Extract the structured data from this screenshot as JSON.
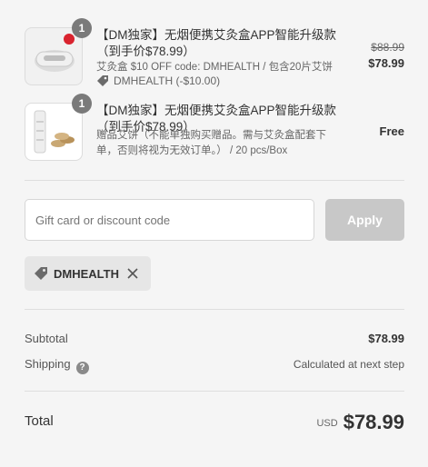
{
  "items": [
    {
      "quantity": "1",
      "title": "【DM独家】无烟便携艾灸盒APP智能升级款（到手价$78.99）",
      "variant": "艾灸盒 $10 OFF code: DMHEALTH / 包含20片艾饼",
      "discount": "DMHEALTH (-$10.00)",
      "original_price": "$88.99",
      "price": "$78.99"
    },
    {
      "quantity": "1",
      "title": "【DM独家】无烟便携艾灸盒APP智能升级款（到手价$78.99）",
      "variant": "赠品艾饼（不能单独购买赠品。需与艾灸盒配套下单，否则将视为无效订单。） / 20 pcs/Box",
      "price": "Free"
    }
  ],
  "discount_input": {
    "placeholder": "Gift card or discount code"
  },
  "apply_label": "Apply",
  "applied_code": "DMHEALTH",
  "summary": {
    "subtotal_label": "Subtotal",
    "subtotal_value": "$78.99",
    "shipping_label": "Shipping",
    "shipping_help": "?",
    "shipping_value": "Calculated at next step",
    "total_label": "Total",
    "currency": "USD",
    "total_value": "$78.99"
  },
  "colors": {
    "badge": "#7a7a7a",
    "apply_disabled": "#c8c8c8",
    "tag_bg": "#e6e6e6",
    "device_red": "#d9232e"
  }
}
